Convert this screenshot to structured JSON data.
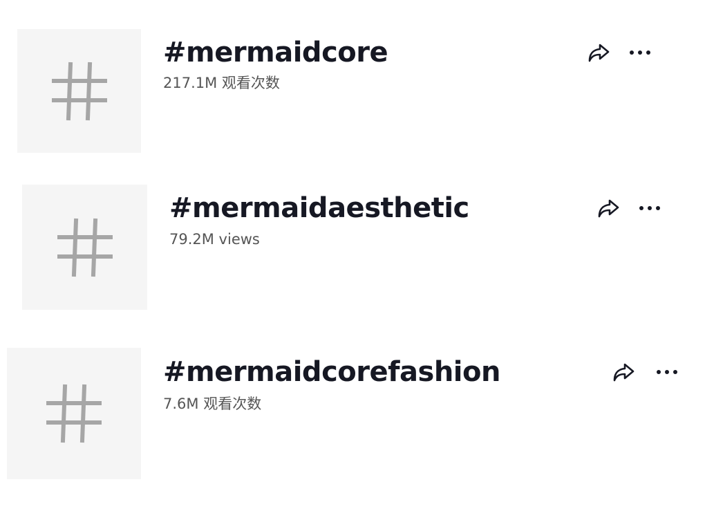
{
  "hashtags": [
    {
      "title": "#mermaidcore",
      "views": "217.1M 观看次数",
      "thumb_icon": "hashtag-icon",
      "share_icon": "share-arrow-icon",
      "more_icon": "more-dots-icon"
    },
    {
      "title": "#mermaidaesthetic",
      "views": "79.2M views",
      "thumb_icon": "hashtag-icon",
      "share_icon": "share-arrow-icon",
      "more_icon": "more-dots-icon"
    },
    {
      "title": "#mermaidcorefashion",
      "views": "7.6M 观看次数",
      "thumb_icon": "hashtag-icon",
      "share_icon": "share-arrow-icon",
      "more_icon": "more-dots-icon"
    }
  ],
  "colors": {
    "title": "#161823",
    "views": "#555555",
    "thumb_bg": "#f5f5f5",
    "hash_glyph": "#a6a6a6"
  }
}
